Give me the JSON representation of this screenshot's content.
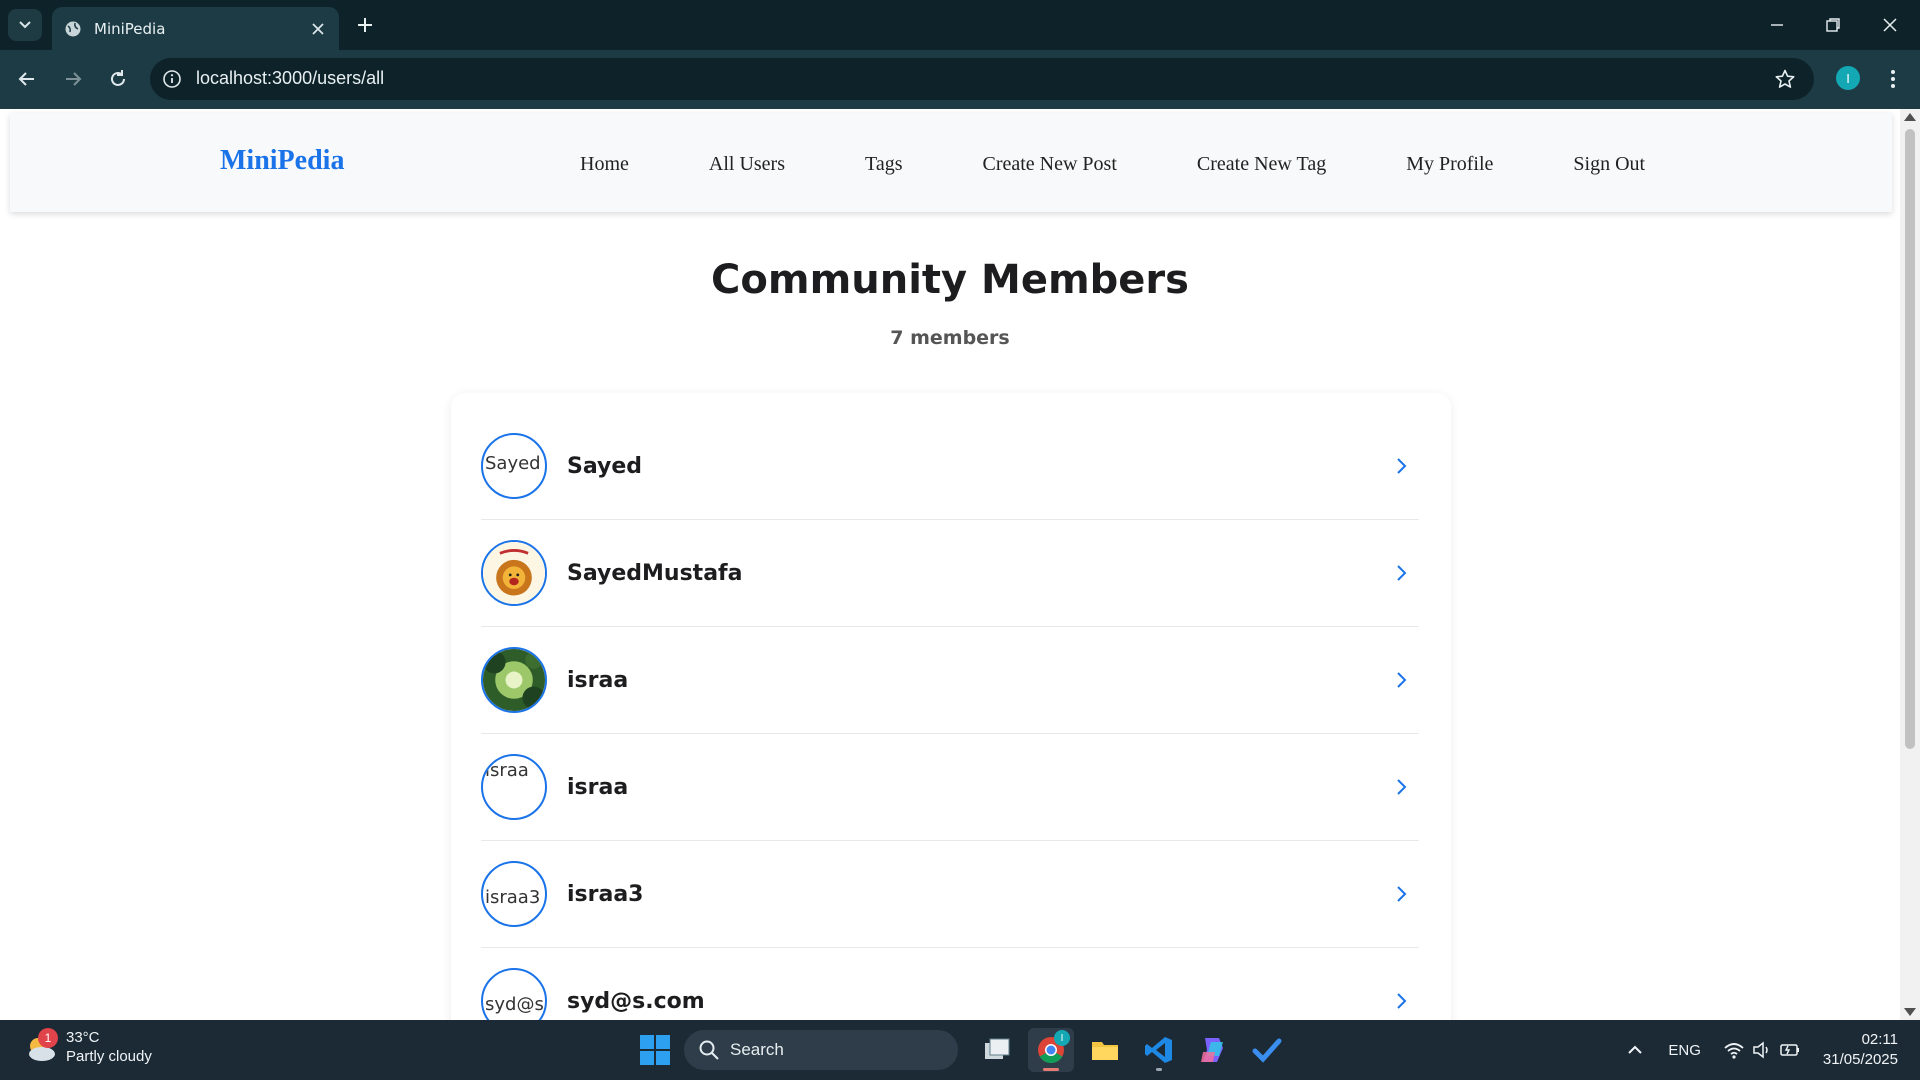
{
  "browser": {
    "tab_title": "MiniPedia",
    "url": "localhost:3000/users/all",
    "profile_initial": "I"
  },
  "site": {
    "brand": "MiniPedia",
    "nav": [
      "Home",
      "All Users",
      "Tags",
      "Create New Post",
      "Create New Tag",
      "My Profile",
      "Sign Out"
    ]
  },
  "page": {
    "title": "Community Members",
    "count": "7 members"
  },
  "members": [
    {
      "name": "Sayed",
      "avatar_alt": "Sayed",
      "avatar_icon": "broken-image"
    },
    {
      "name": "SayedMustafa",
      "avatar_alt": "",
      "avatar_icon": "lion-cartoon"
    },
    {
      "name": "israa",
      "avatar_alt": "",
      "avatar_icon": "forest-canopy"
    },
    {
      "name": "israa",
      "avatar_alt": "israa",
      "avatar_icon": "broken-image"
    },
    {
      "name": "israa3",
      "avatar_alt": "israa3",
      "avatar_icon": "broken-image"
    },
    {
      "name": "syd@s.com",
      "avatar_alt": "syd@s",
      "avatar_icon": "broken-image"
    }
  ],
  "taskbar": {
    "weather_temp": "33°C",
    "weather_desc": "Partly cloudy",
    "weather_badge": "1",
    "search_placeholder": "Search",
    "chrome_badge": "I",
    "language": "ENG",
    "time": "02:11",
    "date": "31/05/2025"
  },
  "colors": {
    "brand": "#1a73e8",
    "avatar_border": "#1a73e8",
    "chevron": "#1a73e8"
  }
}
